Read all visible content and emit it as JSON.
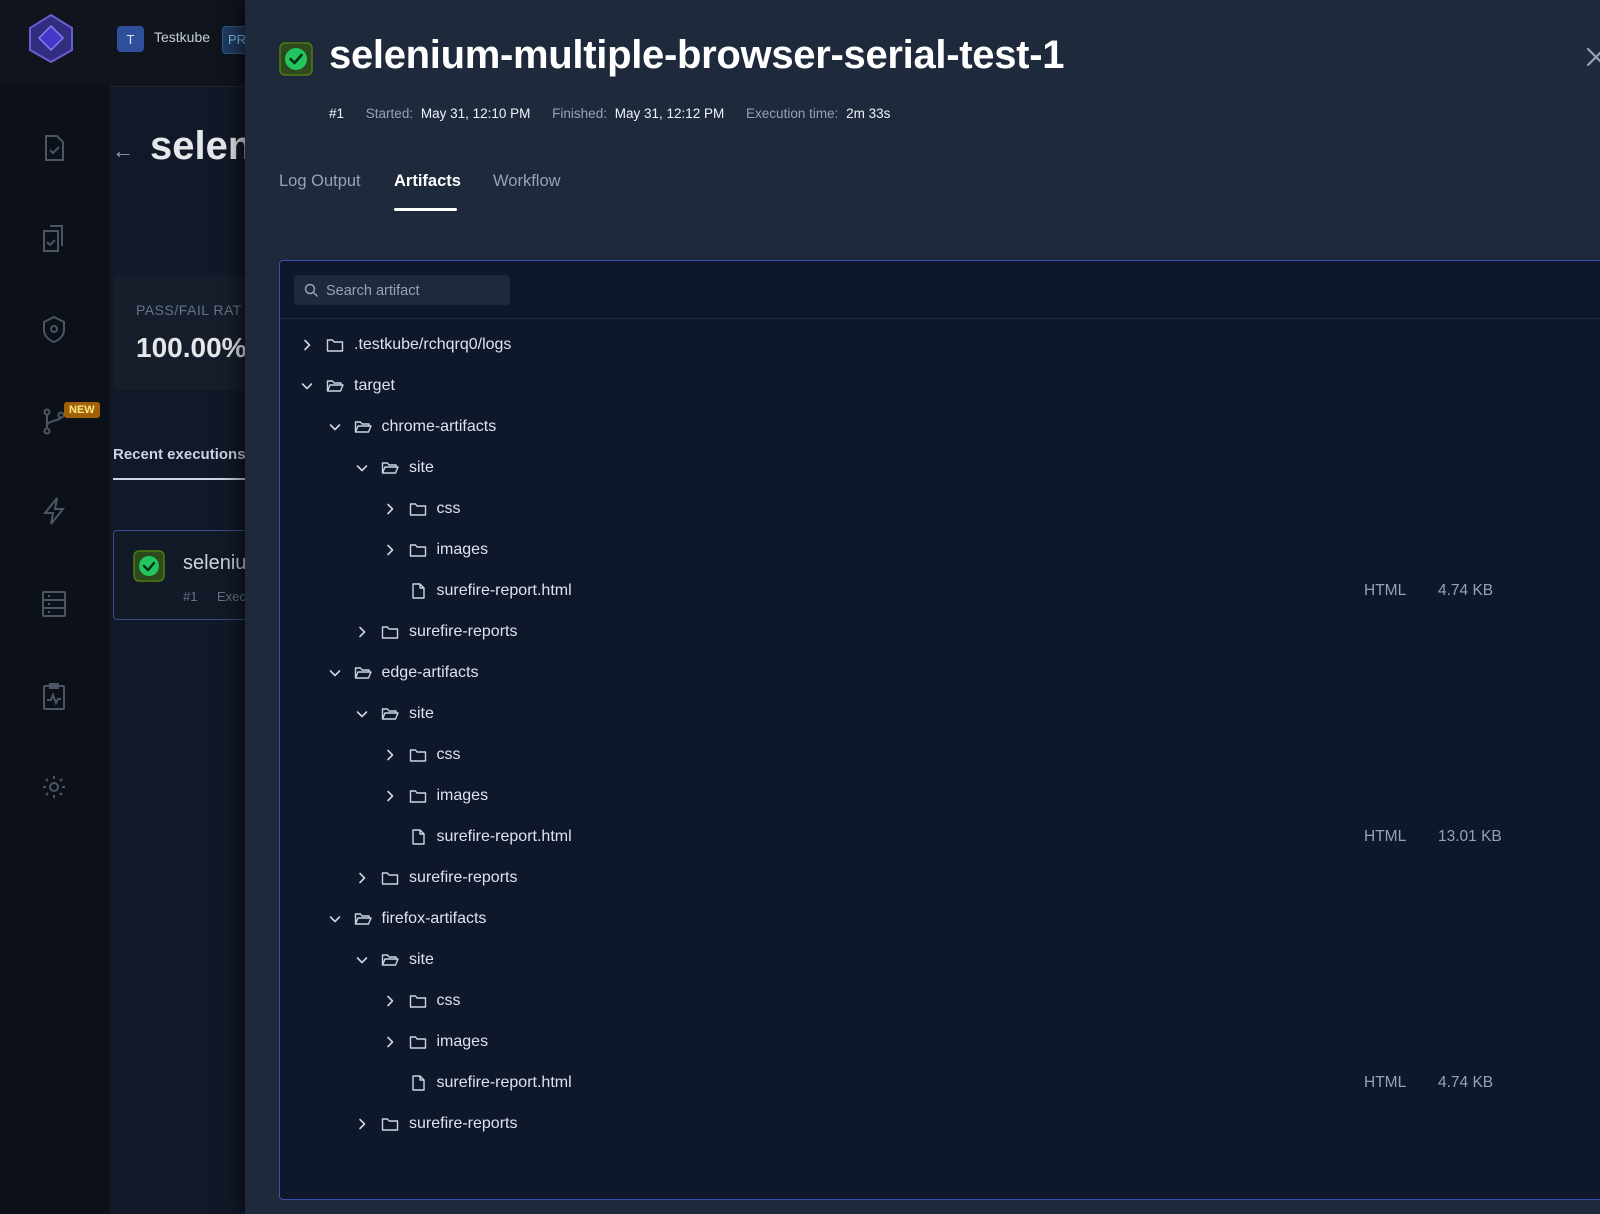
{
  "background": {
    "org_initial": "T",
    "org_name": "Testkube",
    "org_badge": "PR",
    "new_badge": "NEW",
    "back_arrow": "←",
    "page_title_partial": "selen",
    "pass_fail_label": "PASS/FAIL RAT",
    "pass_fail_value": "100.00%",
    "recent_executions_label": "Recent executions",
    "recent_exec_name_partial": "seleniu",
    "recent_exec_number": "#1",
    "recent_exec_sub_partial": "Exec",
    "nav_icons": [
      "test-icon",
      "test-suites-icon",
      "executors-icon",
      "workflows-icon",
      "triggers-icon",
      "sources-icon",
      "status-pages-icon",
      "settings-icon"
    ]
  },
  "execution": {
    "title": "selenium-multiple-browser-serial-test-1",
    "status": "passed",
    "number": "#1",
    "started_label": "Started:",
    "started_value": "May 31, 12:10 PM",
    "finished_label": "Finished:",
    "finished_value": "May 31, 12:12 PM",
    "exec_time_label": "Execution time:",
    "exec_time_value": "2m 33s"
  },
  "tabs": [
    {
      "label": "Log Output",
      "active": false
    },
    {
      "label": "Artifacts",
      "active": true
    },
    {
      "label": "Workflow",
      "active": false
    }
  ],
  "artifacts": {
    "search_placeholder": "Search artifact",
    "tree": [
      {
        "depth": 0,
        "kind": "folder",
        "expanded": false,
        "name": ".testkube/rchqrq0/logs"
      },
      {
        "depth": 0,
        "kind": "folder",
        "expanded": true,
        "name": "target"
      },
      {
        "depth": 1,
        "kind": "folder",
        "expanded": true,
        "name": "chrome-artifacts"
      },
      {
        "depth": 2,
        "kind": "folder",
        "expanded": true,
        "name": "site"
      },
      {
        "depth": 3,
        "kind": "folder",
        "expanded": false,
        "name": "css"
      },
      {
        "depth": 3,
        "kind": "folder",
        "expanded": false,
        "name": "images"
      },
      {
        "depth": 3,
        "kind": "file",
        "name": "surefire-report.html",
        "type": "HTML",
        "size": "4.74 KB"
      },
      {
        "depth": 2,
        "kind": "folder",
        "expanded": false,
        "name": "surefire-reports"
      },
      {
        "depth": 1,
        "kind": "folder",
        "expanded": true,
        "name": "edge-artifacts"
      },
      {
        "depth": 2,
        "kind": "folder",
        "expanded": true,
        "name": "site"
      },
      {
        "depth": 3,
        "kind": "folder",
        "expanded": false,
        "name": "css"
      },
      {
        "depth": 3,
        "kind": "folder",
        "expanded": false,
        "name": "images"
      },
      {
        "depth": 3,
        "kind": "file",
        "name": "surefire-report.html",
        "type": "HTML",
        "size": "13.01 KB"
      },
      {
        "depth": 2,
        "kind": "folder",
        "expanded": false,
        "name": "surefire-reports"
      },
      {
        "depth": 1,
        "kind": "folder",
        "expanded": true,
        "name": "firefox-artifacts"
      },
      {
        "depth": 2,
        "kind": "folder",
        "expanded": true,
        "name": "site"
      },
      {
        "depth": 3,
        "kind": "folder",
        "expanded": false,
        "name": "css"
      },
      {
        "depth": 3,
        "kind": "folder",
        "expanded": false,
        "name": "images"
      },
      {
        "depth": 3,
        "kind": "file",
        "name": "surefire-report.html",
        "type": "HTML",
        "size": "4.74 KB"
      },
      {
        "depth": 2,
        "kind": "folder",
        "expanded": false,
        "name": "surefire-reports"
      }
    ]
  },
  "colors": {
    "accent_border": "#3b4fa8",
    "success": "#16a34a",
    "new_badge": "#a16207"
  }
}
